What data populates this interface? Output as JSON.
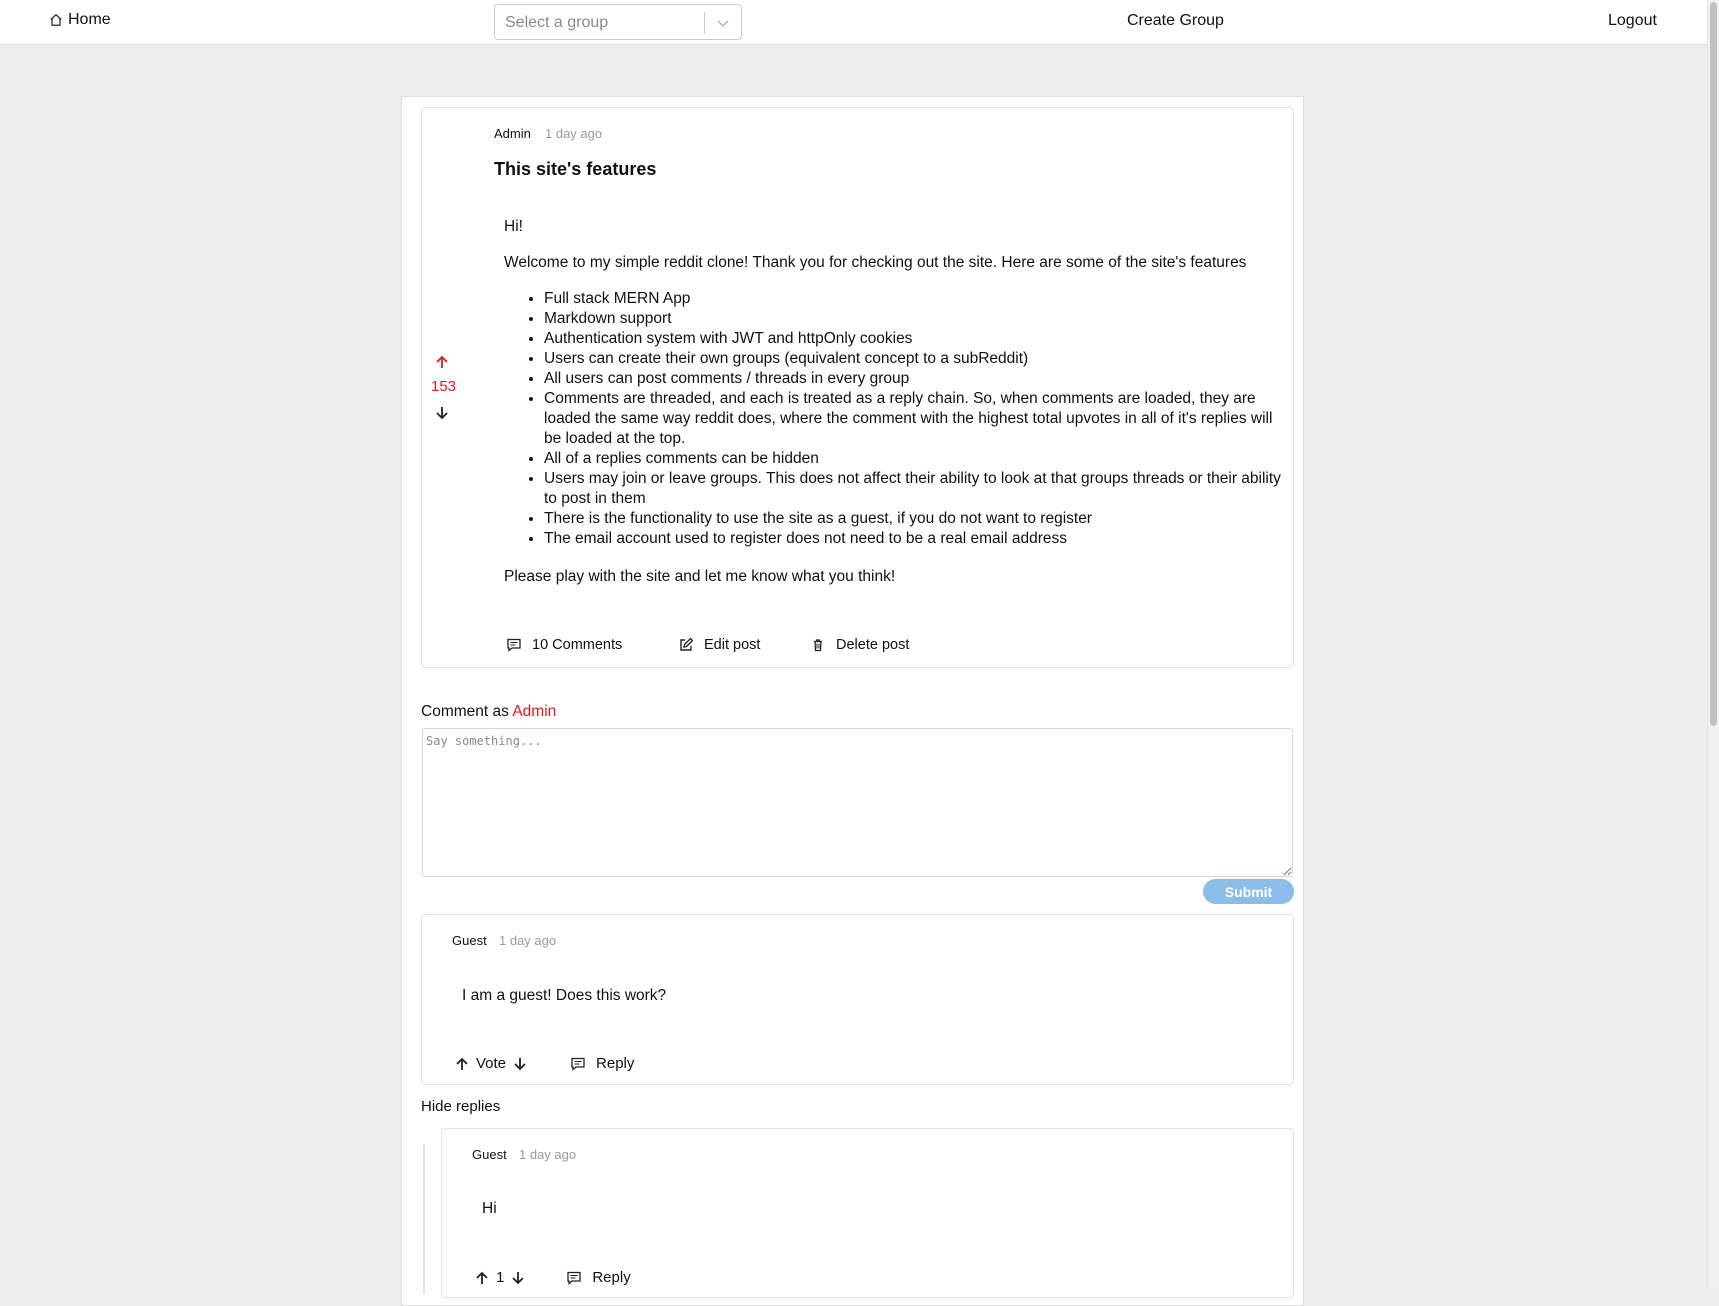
{
  "nav": {
    "home_label": "Home",
    "group_select_placeholder": "Select a group",
    "create_group_label": "Create Group",
    "logout_label": "Logout"
  },
  "post": {
    "author": "Admin",
    "time": "1 day ago",
    "title": "This site's features",
    "votes": "153",
    "body": {
      "greeting": "Hi!",
      "intro": "Welcome to my simple reddit clone! Thank you for checking out the site. Here are some of the site's features",
      "features": [
        "Full stack MERN App",
        "Markdown support",
        "Authentication system with JWT and httpOnly cookies",
        "Users can create their own groups (equivalent concept to a subReddit)",
        "All users can post comments / threads in every group",
        "Comments are threaded, and each is treated as a reply chain. So, when comments are loaded, they are loaded the same way reddit does, where the comment with the highest total upvotes in all of it's replies will be loaded at the top.",
        "All of a replies comments can be hidden",
        "Users may join or leave groups. This does not affect their ability to look at that groups threads or their ability to post in them",
        "There is the functionality to use the site as a guest, if you do not want to register",
        "The email account used to register does not need to be a real email address"
      ],
      "outro": "Please play with the site and let me know what you think!"
    },
    "actions": {
      "comments_label": "10 Comments",
      "edit_label": "Edit post",
      "delete_label": "Delete post"
    }
  },
  "comment_form": {
    "prefix": "Comment as",
    "user": "Admin",
    "placeholder": "Say something...",
    "submit_label": "Submit"
  },
  "comments": [
    {
      "author": "Guest",
      "time": "1 day ago",
      "text": "I am a guest! Does this work?",
      "vote_label": "Vote",
      "reply_label": "Reply"
    },
    {
      "author": "Guest",
      "time": "1 day ago",
      "text": "Hi",
      "vote_label": "1",
      "reply_label": "Reply"
    }
  ],
  "hide_replies_label": "Hide replies",
  "colors": {
    "accent_red": "#e0191f",
    "submit_blue": "#8bbde8",
    "background": "#ededed"
  },
  "icons": [
    "home-icon",
    "chevron-down-icon",
    "upvote-arrow-icon",
    "downvote-arrow-icon",
    "comment-icon",
    "edit-icon",
    "trash-icon"
  ]
}
